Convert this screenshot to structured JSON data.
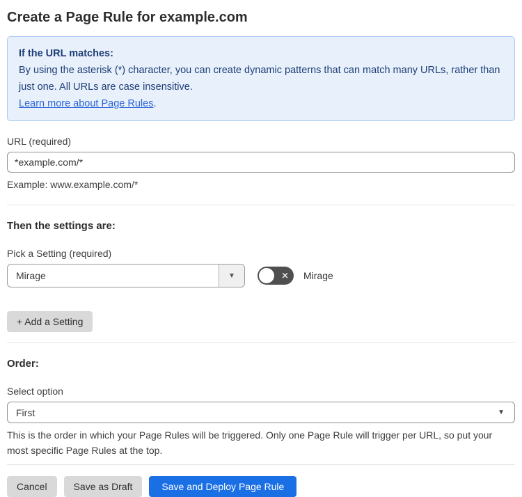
{
  "page": {
    "title": "Create a Page Rule for example.com"
  },
  "info_box": {
    "heading": "If the URL matches:",
    "body": "By using the asterisk (*) character, you can create dynamic patterns that can match many URLs, rather than just one. All URLs are case insensitive.",
    "link_label": "Learn more about Page Rules",
    "link_suffix": "."
  },
  "url_field": {
    "label": "URL (required)",
    "value": "*example.com/*",
    "helper": "Example: www.example.com/*"
  },
  "settings_section": {
    "heading": "Then the settings are:",
    "picker_label": "Pick a Setting (required)",
    "selected_setting": "Mirage",
    "dropdown_arrow": "▼",
    "toggle": {
      "state": "off",
      "off_glyph": "✕",
      "label": "Mirage"
    },
    "add_button_label": "+ Add a Setting"
  },
  "order_section": {
    "heading": "Order:",
    "select_label": "Select option",
    "selected_option": "First",
    "dropdown_arrow": "▼",
    "helper": "This is the order in which your Page Rules will be triggered. Only one Page Rule will trigger per URL, so put your most specific Page Rules at the top."
  },
  "footer": {
    "cancel_label": "Cancel",
    "save_draft_label": "Save as Draft",
    "save_deploy_label": "Save and Deploy Page Rule"
  },
  "colors": {
    "info_bg": "#e8f1fb",
    "info_border": "#a9c9ee",
    "info_text": "#1e3d77",
    "link_blue": "#2d64d8",
    "primary_button_bg": "#1a6fe5",
    "gray_button_bg": "#d9d9d9",
    "toggle_off_bg": "#4f4f4f"
  }
}
